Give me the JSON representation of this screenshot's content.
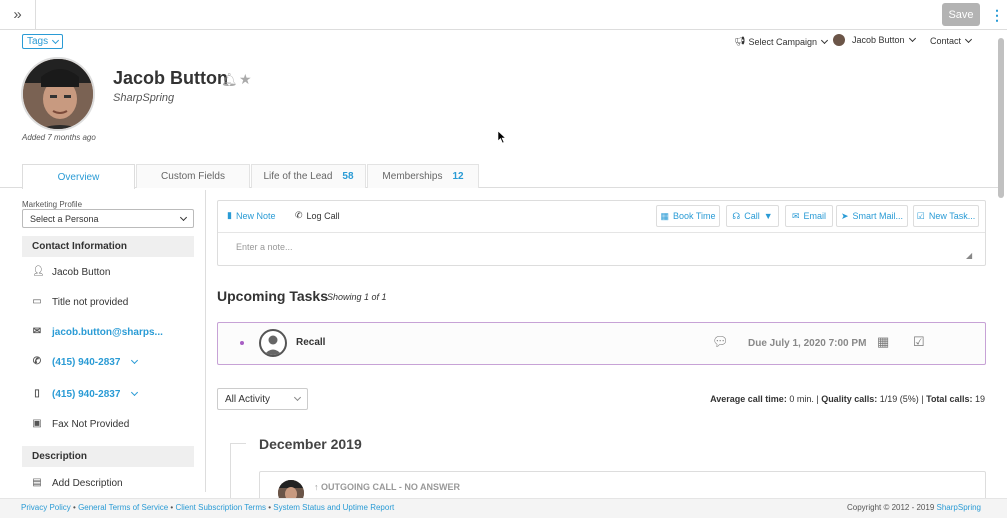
{
  "topbar": {
    "save_label": "Save"
  },
  "tags_label": "Tags",
  "top_nav": {
    "campaign": "Select Campaign",
    "user": "Jacob Button",
    "contact": "Contact"
  },
  "profile": {
    "name": "Jacob Button",
    "company": "SharpSpring",
    "added": "Added 7 months ago"
  },
  "tabs": [
    {
      "label": "Overview",
      "count": ""
    },
    {
      "label": "Custom Fields",
      "count": ""
    },
    {
      "label": "Life of the Lead",
      "count": "58"
    },
    {
      "label": "Memberships",
      "count": "12"
    }
  ],
  "sidebar": {
    "marketing_profile_label": "Marketing Profile",
    "persona_value": "Select a Persona",
    "contact_info_heading": "Contact Information",
    "contact_info": {
      "name": "Jacob Button",
      "title": "Title not provided",
      "email": "jacob.button@sharps...",
      "phone1": "(415) 940-2837",
      "phone2": "(415) 940-2837",
      "fax": "Fax Not Provided"
    },
    "description_heading": "Description",
    "add_description": "Add Description"
  },
  "note": {
    "new_note": "New Note",
    "log_call": "Log Call",
    "placeholder": "Enter a note...",
    "actions": {
      "book_time": "Book Time",
      "call": "Call",
      "email": "Email",
      "smart_mail": "Smart Mail...",
      "new_task": "New Task..."
    }
  },
  "upcoming": {
    "heading": "Upcoming Tasks",
    "showing": "Showing 1 of 1",
    "task": {
      "title": "Recall",
      "due": "Due July 1, 2020 7:00 PM"
    }
  },
  "activity": {
    "filter_value": "All Activity",
    "stats": {
      "avg_label": "Average call time:",
      "avg_value": "0 min.",
      "quality_label": "Quality calls:",
      "quality_value": "1/19 (5%)",
      "total_label": "Total calls:",
      "total_value": "19"
    },
    "month": "December 2019",
    "item_title": "OUTGOING CALL - NO ANSWER"
  },
  "footer": {
    "links": [
      "Privacy Policy",
      "General Terms of Service",
      "Client Subscription Terms",
      "System Status and Uptime Report"
    ],
    "copyright_prefix": "Copyright © 2012 - 2019",
    "copyright_brand": "SharpSpring"
  },
  "colors": {
    "accent": "#2a9bd5",
    "task_border": "#c7a2d6",
    "task_dot": "#a85fc4"
  }
}
